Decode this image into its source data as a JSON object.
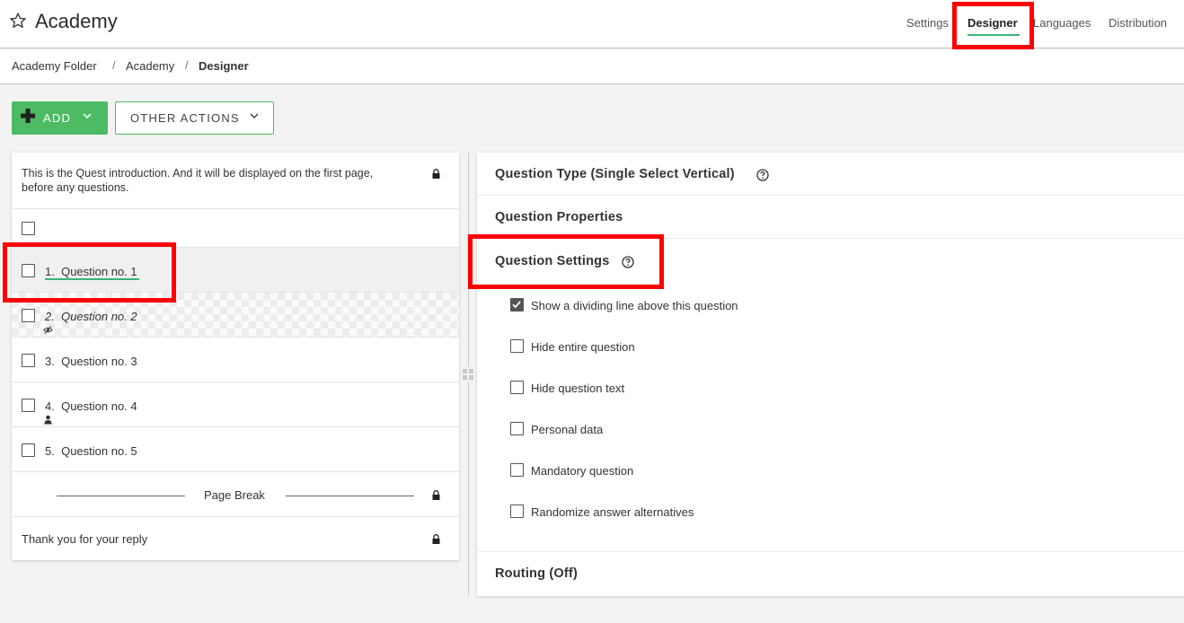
{
  "header": {
    "title": "Academy",
    "favorite_icon": "star-outline-icon",
    "nav": [
      "Settings",
      "Designer",
      "Languages",
      "Distribution"
    ],
    "active_nav": "Designer",
    "accent_color": "#3cb371"
  },
  "breadcrumb": {
    "items": [
      "Academy Folder",
      "Academy",
      "Designer"
    ],
    "separator": "/"
  },
  "toolbar": {
    "add_label": "ADD",
    "other_actions_label": "OTHER ACTIONS"
  },
  "question_list": {
    "intro_text": "This is the Quest introduction. And it will be displayed on the first page, before any questions.",
    "questions": [
      {
        "number": "1.",
        "label": "Question no. 1",
        "selected": true
      },
      {
        "number": "2.",
        "label": "Question no. 2",
        "hidden": true
      },
      {
        "number": "3.",
        "label": "Question no. 3"
      },
      {
        "number": "4.",
        "label": "Question no. 4",
        "personal_data": true
      },
      {
        "number": "5.",
        "label": "Question no. 5"
      }
    ],
    "page_break_label": "Page Break",
    "thanks_text": "Thank you for your reply"
  },
  "properties": {
    "question_type_label": "Question Type (Single Select Vertical)",
    "question_properties_label": "Question Properties",
    "question_settings_label": "Question Settings",
    "settings": [
      {
        "label": "Show a dividing line above this question",
        "checked": true
      },
      {
        "label": "Hide entire question",
        "checked": false
      },
      {
        "label": "Hide question text",
        "checked": false
      },
      {
        "label": "Personal data",
        "checked": false
      },
      {
        "label": "Mandatory question",
        "checked": false
      },
      {
        "label": "Randomize answer alternatives",
        "checked": false
      }
    ],
    "routing_label": "Routing (Off)"
  },
  "colors": {
    "highlight": "#ff0000",
    "add_button": "#4cbb64"
  }
}
